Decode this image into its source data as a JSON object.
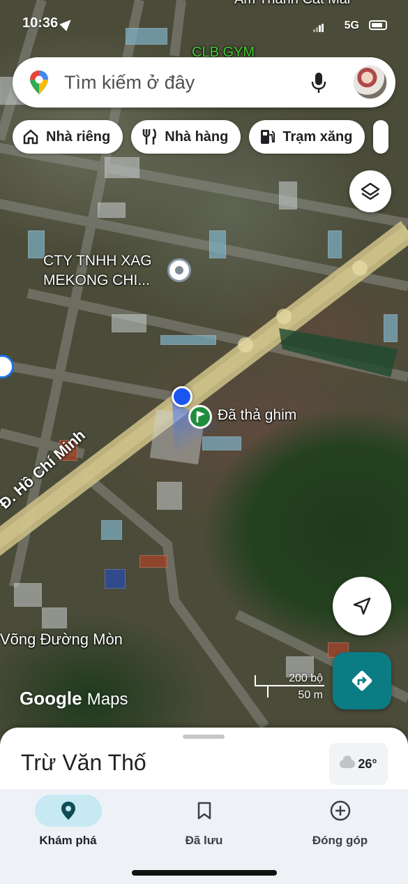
{
  "status_bar": {
    "time": "10:36",
    "network": "5G"
  },
  "search": {
    "placeholder": "Tìm kiếm ở đây"
  },
  "chips": [
    {
      "label": "Nhà riêng",
      "icon": "home-icon"
    },
    {
      "label": "Nhà hàng",
      "icon": "restaurant-icon"
    },
    {
      "label": "Trạm xăng",
      "icon": "gas-station-icon"
    }
  ],
  "map": {
    "top_label": "Ấm Thành Cát Mai",
    "top_label2": "CLB GYM",
    "poi_line1": "CTY TNHH XAG",
    "poi_line2": "MEKONG CHI...",
    "dropped_pin": "Đã thả ghim",
    "road_label": "Đ. Hồ Chí Minh",
    "village_label": "Võng Đường Mòn",
    "brand_google": "Google",
    "brand_maps": "Maps",
    "scale_top": "200 bộ",
    "scale_bottom": "50 m"
  },
  "sheet": {
    "title": "Trừ Văn Thố",
    "temperature": "26°"
  },
  "nav": [
    {
      "label": "Khám phá",
      "icon": "explore-pin-icon",
      "active": true
    },
    {
      "label": "Đã lưu",
      "icon": "bookmark-icon",
      "active": false
    },
    {
      "label": "Đóng góp",
      "icon": "add-circle-icon",
      "active": false
    }
  ],
  "colors": {
    "accent": "#0b7c84",
    "location_blue": "#1a55f0",
    "nav_active": "#c6e9f2"
  }
}
